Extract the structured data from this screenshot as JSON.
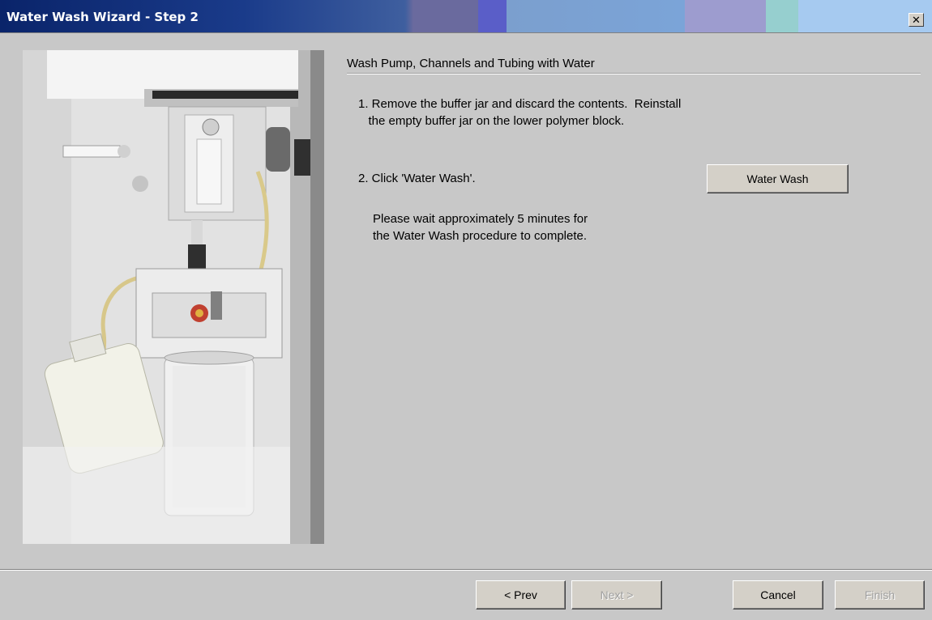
{
  "window": {
    "title": "Water Wash Wizard - Step 2",
    "close_label": "✕"
  },
  "content": {
    "section_title": "Wash Pump, Channels and Tubing with Water",
    "step1": "1. Remove the buffer jar and discard the contents.  Reinstall\n   the empty buffer jar on the lower polymer block.",
    "step2": "2. Click 'Water Wash'.",
    "wait_text": "Please wait approximately 5 minutes for\nthe Water Wash procedure to complete.",
    "water_wash_label": "Water Wash"
  },
  "footer": {
    "prev_label": "< Prev",
    "next_label": "Next >",
    "cancel_label": "Cancel",
    "finish_label": "Finish"
  },
  "colors": {
    "title_bar_start": "#0a246a",
    "dialog_background": "#c8c8c8",
    "button_face": "#d4d0c8"
  }
}
